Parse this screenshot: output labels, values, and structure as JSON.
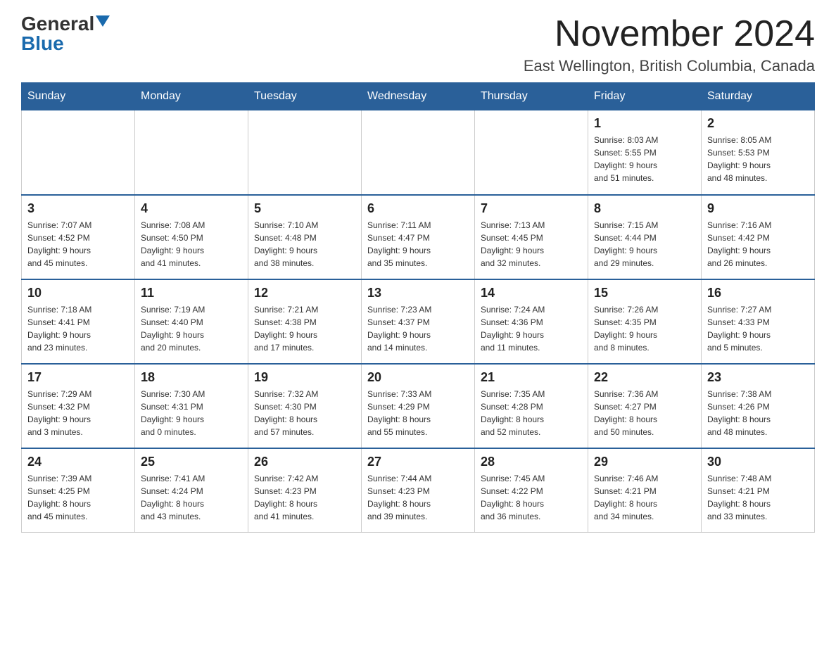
{
  "header": {
    "logo_general": "General",
    "logo_blue": "Blue",
    "month_title": "November 2024",
    "location": "East Wellington, British Columbia, Canada"
  },
  "days_of_week": [
    "Sunday",
    "Monday",
    "Tuesday",
    "Wednesday",
    "Thursday",
    "Friday",
    "Saturday"
  ],
  "weeks": [
    [
      {
        "day": "",
        "info": ""
      },
      {
        "day": "",
        "info": ""
      },
      {
        "day": "",
        "info": ""
      },
      {
        "day": "",
        "info": ""
      },
      {
        "day": "",
        "info": ""
      },
      {
        "day": "1",
        "info": "Sunrise: 8:03 AM\nSunset: 5:55 PM\nDaylight: 9 hours\nand 51 minutes."
      },
      {
        "day": "2",
        "info": "Sunrise: 8:05 AM\nSunset: 5:53 PM\nDaylight: 9 hours\nand 48 minutes."
      }
    ],
    [
      {
        "day": "3",
        "info": "Sunrise: 7:07 AM\nSunset: 4:52 PM\nDaylight: 9 hours\nand 45 minutes."
      },
      {
        "day": "4",
        "info": "Sunrise: 7:08 AM\nSunset: 4:50 PM\nDaylight: 9 hours\nand 41 minutes."
      },
      {
        "day": "5",
        "info": "Sunrise: 7:10 AM\nSunset: 4:48 PM\nDaylight: 9 hours\nand 38 minutes."
      },
      {
        "day": "6",
        "info": "Sunrise: 7:11 AM\nSunset: 4:47 PM\nDaylight: 9 hours\nand 35 minutes."
      },
      {
        "day": "7",
        "info": "Sunrise: 7:13 AM\nSunset: 4:45 PM\nDaylight: 9 hours\nand 32 minutes."
      },
      {
        "day": "8",
        "info": "Sunrise: 7:15 AM\nSunset: 4:44 PM\nDaylight: 9 hours\nand 29 minutes."
      },
      {
        "day": "9",
        "info": "Sunrise: 7:16 AM\nSunset: 4:42 PM\nDaylight: 9 hours\nand 26 minutes."
      }
    ],
    [
      {
        "day": "10",
        "info": "Sunrise: 7:18 AM\nSunset: 4:41 PM\nDaylight: 9 hours\nand 23 minutes."
      },
      {
        "day": "11",
        "info": "Sunrise: 7:19 AM\nSunset: 4:40 PM\nDaylight: 9 hours\nand 20 minutes."
      },
      {
        "day": "12",
        "info": "Sunrise: 7:21 AM\nSunset: 4:38 PM\nDaylight: 9 hours\nand 17 minutes."
      },
      {
        "day": "13",
        "info": "Sunrise: 7:23 AM\nSunset: 4:37 PM\nDaylight: 9 hours\nand 14 minutes."
      },
      {
        "day": "14",
        "info": "Sunrise: 7:24 AM\nSunset: 4:36 PM\nDaylight: 9 hours\nand 11 minutes."
      },
      {
        "day": "15",
        "info": "Sunrise: 7:26 AM\nSunset: 4:35 PM\nDaylight: 9 hours\nand 8 minutes."
      },
      {
        "day": "16",
        "info": "Sunrise: 7:27 AM\nSunset: 4:33 PM\nDaylight: 9 hours\nand 5 minutes."
      }
    ],
    [
      {
        "day": "17",
        "info": "Sunrise: 7:29 AM\nSunset: 4:32 PM\nDaylight: 9 hours\nand 3 minutes."
      },
      {
        "day": "18",
        "info": "Sunrise: 7:30 AM\nSunset: 4:31 PM\nDaylight: 9 hours\nand 0 minutes."
      },
      {
        "day": "19",
        "info": "Sunrise: 7:32 AM\nSunset: 4:30 PM\nDaylight: 8 hours\nand 57 minutes."
      },
      {
        "day": "20",
        "info": "Sunrise: 7:33 AM\nSunset: 4:29 PM\nDaylight: 8 hours\nand 55 minutes."
      },
      {
        "day": "21",
        "info": "Sunrise: 7:35 AM\nSunset: 4:28 PM\nDaylight: 8 hours\nand 52 minutes."
      },
      {
        "day": "22",
        "info": "Sunrise: 7:36 AM\nSunset: 4:27 PM\nDaylight: 8 hours\nand 50 minutes."
      },
      {
        "day": "23",
        "info": "Sunrise: 7:38 AM\nSunset: 4:26 PM\nDaylight: 8 hours\nand 48 minutes."
      }
    ],
    [
      {
        "day": "24",
        "info": "Sunrise: 7:39 AM\nSunset: 4:25 PM\nDaylight: 8 hours\nand 45 minutes."
      },
      {
        "day": "25",
        "info": "Sunrise: 7:41 AM\nSunset: 4:24 PM\nDaylight: 8 hours\nand 43 minutes."
      },
      {
        "day": "26",
        "info": "Sunrise: 7:42 AM\nSunset: 4:23 PM\nDaylight: 8 hours\nand 41 minutes."
      },
      {
        "day": "27",
        "info": "Sunrise: 7:44 AM\nSunset: 4:23 PM\nDaylight: 8 hours\nand 39 minutes."
      },
      {
        "day": "28",
        "info": "Sunrise: 7:45 AM\nSunset: 4:22 PM\nDaylight: 8 hours\nand 36 minutes."
      },
      {
        "day": "29",
        "info": "Sunrise: 7:46 AM\nSunset: 4:21 PM\nDaylight: 8 hours\nand 34 minutes."
      },
      {
        "day": "30",
        "info": "Sunrise: 7:48 AM\nSunset: 4:21 PM\nDaylight: 8 hours\nand 33 minutes."
      }
    ]
  ]
}
